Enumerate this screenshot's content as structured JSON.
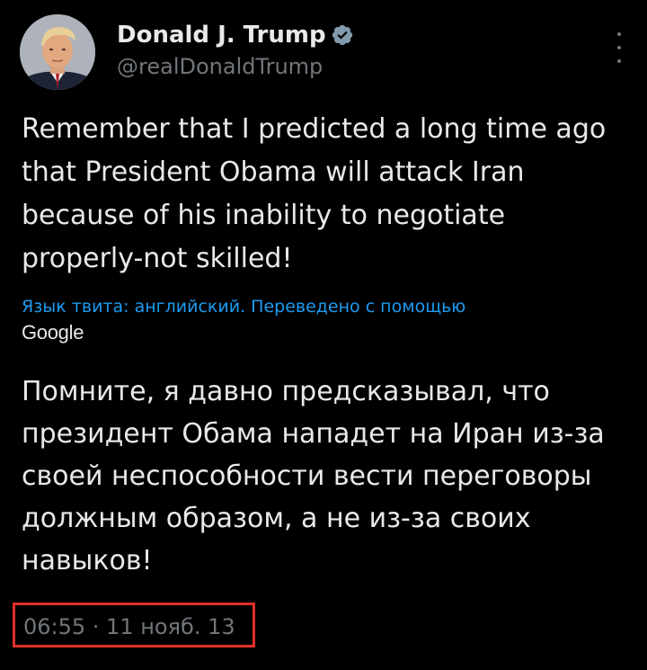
{
  "author": {
    "name": "Donald J. Trump",
    "handle": "@realDonaldTrump",
    "verified_color": "#829aab"
  },
  "tweet": {
    "text": "Remember that I predicted a long time ago that President Obama will attack Iran because of his inability to negotiate properly-not skilled!",
    "translation_note": "Язык твита: английский. Переведено с помощью",
    "translation_provider": "Google",
    "translated_text": "Помните, я давно предсказывал, что президент Обама нападет на Иран из-за своей неспособности вести переговоры должным образом, а не из-за своих навыков!",
    "timestamp": "06:55 · 11 нояб. 13"
  },
  "colors": {
    "background": "#000000",
    "text": "#e7e9ea",
    "secondary": "#71767b",
    "link": "#1d9bf0",
    "highlight_box": "#e0302a"
  },
  "icons": {
    "verified": "verified-badge-icon",
    "more": "more-options-icon"
  }
}
